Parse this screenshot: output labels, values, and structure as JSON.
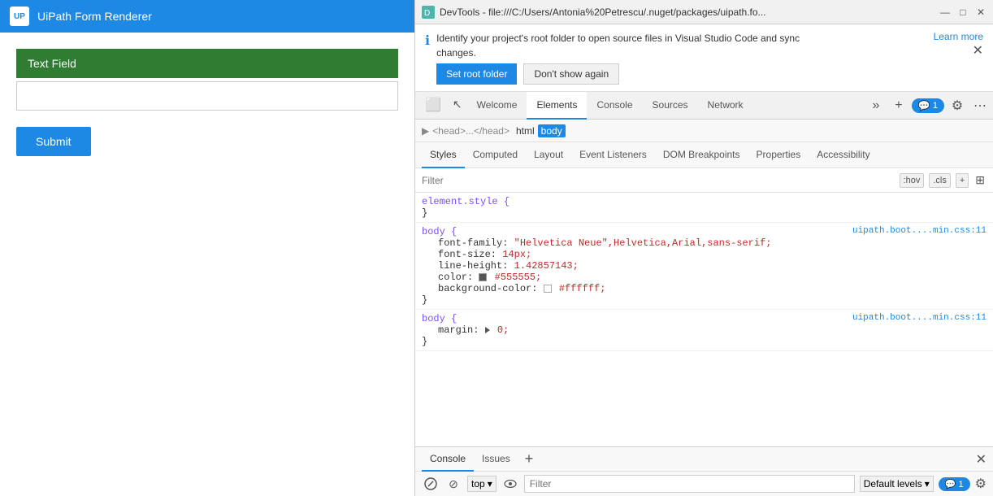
{
  "left": {
    "titlebar": {
      "logo": "UP",
      "title": "UiPath Form Renderer"
    },
    "form": {
      "text_field_label": "Text Field",
      "submit_label": "Submit"
    }
  },
  "devtools": {
    "titlebar": {
      "title": "DevTools - file:///C:/Users/Antonia%20Petrescu/.nuget/packages/uipath.fo...",
      "minimize": "—",
      "maximize": "□",
      "close": "✕"
    },
    "banner": {
      "info_text_line1": "Identify your project's root folder to open source files in Visual Studio Code and sync",
      "info_text_line2": "changes.",
      "set_root_label": "Set root folder",
      "dont_show_label": "Don't show again",
      "learn_more_label": "Learn more"
    },
    "main_tabs": [
      {
        "id": "inspect",
        "label": "",
        "icon": "⬛",
        "type": "icon-only"
      },
      {
        "id": "cursor",
        "label": "",
        "icon": "↖",
        "type": "icon-only"
      },
      {
        "id": "welcome",
        "label": "Welcome"
      },
      {
        "id": "elements",
        "label": "Elements",
        "active": true
      },
      {
        "id": "console",
        "label": "Console"
      },
      {
        "id": "sources",
        "label": "Sources"
      },
      {
        "id": "network",
        "label": "Network"
      }
    ],
    "tab_controls": {
      "more": "»",
      "add": "+",
      "badge_count": "1",
      "settings": "⚙",
      "more_options": "⋯"
    },
    "breadcrumb": {
      "arrow": "▶",
      "items": [
        "html",
        "body"
      ]
    },
    "style_tabs": [
      {
        "id": "styles",
        "label": "Styles",
        "active": true
      },
      {
        "id": "computed",
        "label": "Computed"
      },
      {
        "id": "layout",
        "label": "Layout"
      },
      {
        "id": "event_listeners",
        "label": "Event Listeners"
      },
      {
        "id": "dom_breakpoints",
        "label": "DOM Breakpoints"
      },
      {
        "id": "properties",
        "label": "Properties"
      },
      {
        "id": "accessibility",
        "label": "Accessibility"
      }
    ],
    "filter": {
      "placeholder": "Filter",
      "hov_btn": ":hov",
      "cls_btn": ".cls",
      "add_btn": "+",
      "new_rule_btn": "□"
    },
    "css_blocks": [
      {
        "selector": "element.style {",
        "properties": [],
        "close": "}",
        "source": ""
      },
      {
        "selector": "body {",
        "properties": [
          {
            "name": "font-family:",
            "value": "\"Helvetica Neue\",Helvetica,Arial,sans-serif;"
          },
          {
            "name": "font-size:",
            "value": "14px;"
          },
          {
            "name": "line-height:",
            "value": "1.42857143;"
          },
          {
            "name": "color:",
            "value": "#555555;",
            "swatch": "#555555"
          },
          {
            "name": "background-color:",
            "value": "#ffffff;",
            "swatch": "#ffffff"
          }
        ],
        "close": "}",
        "source": "uipath.boot....min.css:11"
      },
      {
        "selector": "body {",
        "properties": [
          {
            "name": "margin:",
            "value": "0;",
            "triangle": true
          }
        ],
        "close": "}",
        "source": "uipath.boot....min.css:11"
      }
    ],
    "bottom": {
      "tabs": [
        {
          "id": "console",
          "label": "Console",
          "active": true
        },
        {
          "id": "issues",
          "label": "Issues"
        }
      ],
      "add": "+",
      "close": "✕"
    },
    "console_toolbar": {
      "clear_btn": "🚫",
      "block_btn": "⊘",
      "top_label": "top",
      "dropdown_arrow": "▾",
      "eye_btn": "👁",
      "filter_placeholder": "Filter",
      "default_levels": "Default levels",
      "dropdown_arrow2": "▾",
      "badge_count": "1",
      "settings_btn": "⚙"
    }
  }
}
